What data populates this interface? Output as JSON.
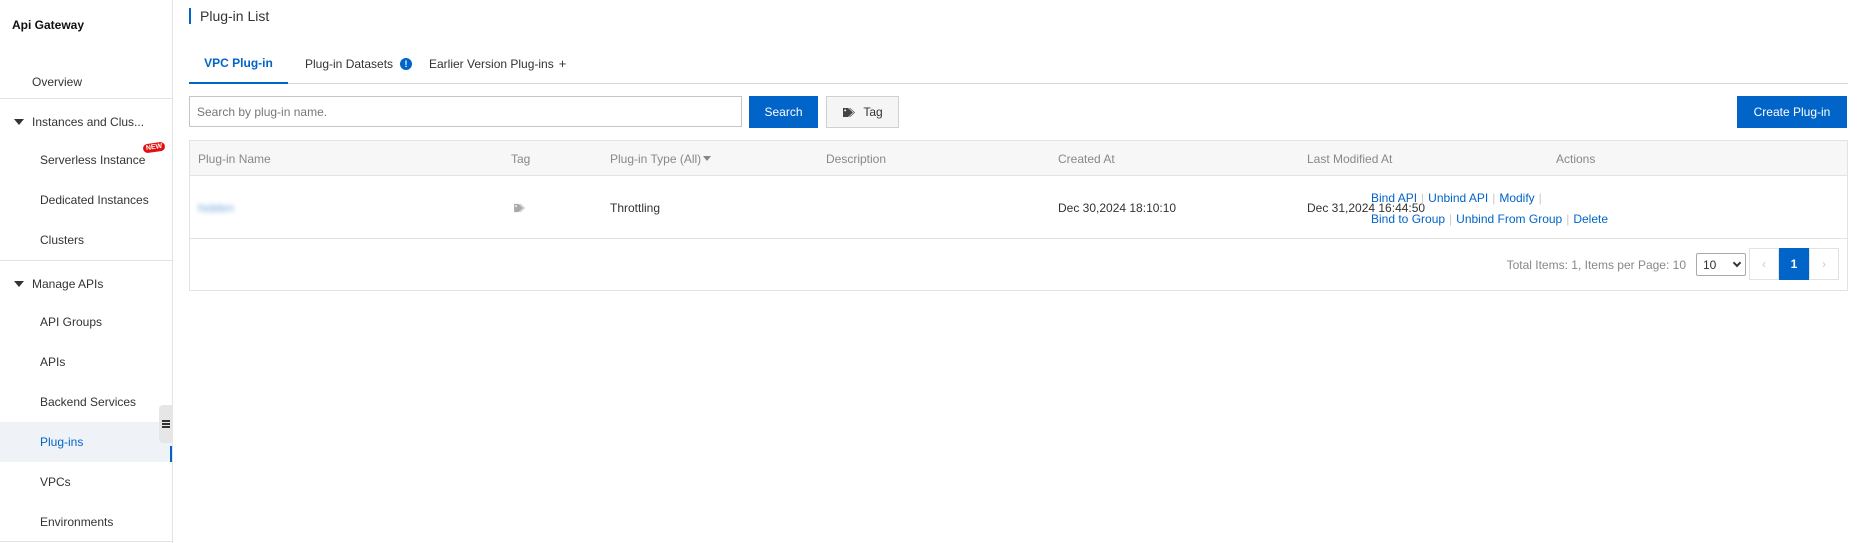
{
  "sidebar": {
    "title": "Api Gateway",
    "overview": "Overview",
    "instances_group": "Instances and Clus...",
    "serverless_instance": "Serverless Instance",
    "new_badge": "NEW",
    "dedicated_instances": "Dedicated Instances",
    "clusters": "Clusters",
    "manage_apis_group": "Manage APIs",
    "api_groups": "API Groups",
    "apis": "APIs",
    "backend_services": "Backend Services",
    "plugins": "Plug-ins",
    "vpcs": "VPCs",
    "environments": "Environments"
  },
  "page": {
    "title": "Plug-in List"
  },
  "tabs": [
    {
      "label": "VPC Plug-in",
      "active": true
    },
    {
      "label": "Plug-in Datasets",
      "info": "!"
    },
    {
      "label": "Earlier Version Plug-ins",
      "suffix": "+"
    }
  ],
  "toolbar": {
    "search_placeholder": "Search by plug-in name.",
    "search_label": "Search",
    "tag_label": "Tag",
    "create_label": "Create Plug-in"
  },
  "table": {
    "columns": [
      "Plug-in Name",
      "Tag",
      "Plug-in Type (All)",
      "Description",
      "Created At",
      "Last Modified At",
      "Actions"
    ],
    "rows": [
      {
        "name": "hidden",
        "type": "Throttling",
        "description": "",
        "created_at": "Dec 30,2024 18:10:10",
        "modified_at": "Dec 31,2024 16:44:50",
        "actions": [
          "Bind API",
          "Unbind API",
          "Modify",
          "Bind to Group",
          "Unbind From Group",
          "Delete"
        ]
      }
    ]
  },
  "pagination": {
    "summary": "Total Items: 1, Items per Page: 10",
    "page_size": "10",
    "current_page": "1",
    "prev": "‹",
    "next": "›"
  },
  "colors": {
    "accent": "#0064c8",
    "new_badge": "#e30f0f"
  }
}
